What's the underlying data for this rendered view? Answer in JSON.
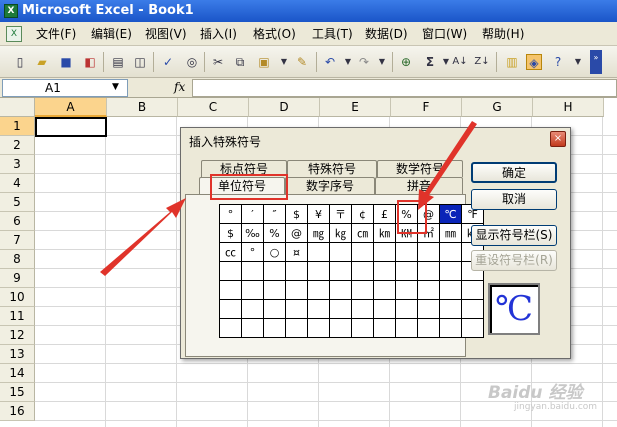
{
  "title": "Microsoft Excel - Book1",
  "menu": [
    "文件(F)",
    "编辑(E)",
    "视图(V)",
    "插入(I)",
    "格式(O)",
    "工具(T)",
    "数据(D)",
    "窗口(W)",
    "帮助(H)"
  ],
  "formula_bar": {
    "cell_ref": "A1",
    "fx": "fx"
  },
  "columns": [
    "A",
    "B",
    "C",
    "D",
    "E",
    "F",
    "G",
    "H"
  ],
  "rows": [
    "1",
    "2",
    "3",
    "4",
    "5",
    "6",
    "7",
    "8",
    "9",
    "10",
    "11",
    "12",
    "13",
    "14",
    "15",
    "16"
  ],
  "dialog": {
    "title": "插入特殊符号",
    "close": "×",
    "tabs_back": [
      "标点符号",
      "特殊符号",
      "数学符号"
    ],
    "tabs_front": [
      "单位符号",
      "数字序号",
      "拼音"
    ],
    "symbols": [
      [
        "°",
        "′",
        "″",
        "$",
        "¥",
        "〒",
        "¢",
        "£",
        "%",
        "@",
        "℃",
        "℉"
      ],
      [
        "$",
        "‰",
        "%",
        "@",
        "㎎",
        "㎏",
        "㎝",
        "㎞",
        "㏎",
        "㎡",
        "㎜",
        "㎏"
      ],
      [
        "㏄",
        "°",
        "○",
        "¤",
        "",
        "",
        "",
        "",
        "",
        "",
        "",
        ""
      ],
      [
        "",
        "",
        "",
        "",
        "",
        "",
        "",
        "",
        "",
        "",
        "",
        ""
      ],
      [
        "",
        "",
        "",
        "",
        "",
        "",
        "",
        "",
        "",
        "",
        "",
        ""
      ],
      [
        "",
        "",
        "",
        "",
        "",
        "",
        "",
        "",
        "",
        "",
        "",
        ""
      ],
      [
        "",
        "",
        "",
        "",
        "",
        "",
        "",
        "",
        "",
        "",
        "",
        ""
      ]
    ],
    "selected_symbol": "℃",
    "buttons": {
      "ok": "确定",
      "cancel": "取消",
      "show_bar": "显示符号栏(S)",
      "reset_bar": "重设符号栏(R)"
    },
    "preview": "℃"
  },
  "watermark": {
    "main": "Baidu 经验",
    "sub": "jingyan.baidu.com"
  },
  "colors": {
    "accent": "#0a24b8",
    "annotation": "#e0332a"
  }
}
